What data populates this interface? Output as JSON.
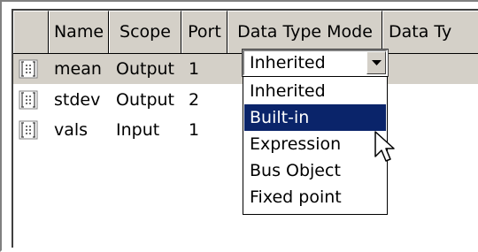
{
  "table": {
    "columns": [
      "",
      "Name",
      "Scope",
      "Port",
      "Data Type Mode",
      "Data Ty"
    ],
    "rows": [
      {
        "name": "mean",
        "scope": "Output",
        "port": "1"
      },
      {
        "name": "stdev",
        "scope": "Output",
        "port": "2"
      },
      {
        "name": "vals",
        "scope": "Input",
        "port": "1"
      }
    ]
  },
  "combo": {
    "selected": "Inherited"
  },
  "dropdown": {
    "options": [
      "Inherited",
      "Built-in",
      "Expression",
      "Bus Object",
      "Fixed point"
    ],
    "highlighted_index": 1
  },
  "colors": {
    "selection": "#0a246a",
    "chrome": "#d4d0c8"
  },
  "icons": {
    "row_icon": "data-object-icon",
    "dropdown_arrow": "chevron-down-icon",
    "cursor": "mouse-pointer-icon"
  }
}
